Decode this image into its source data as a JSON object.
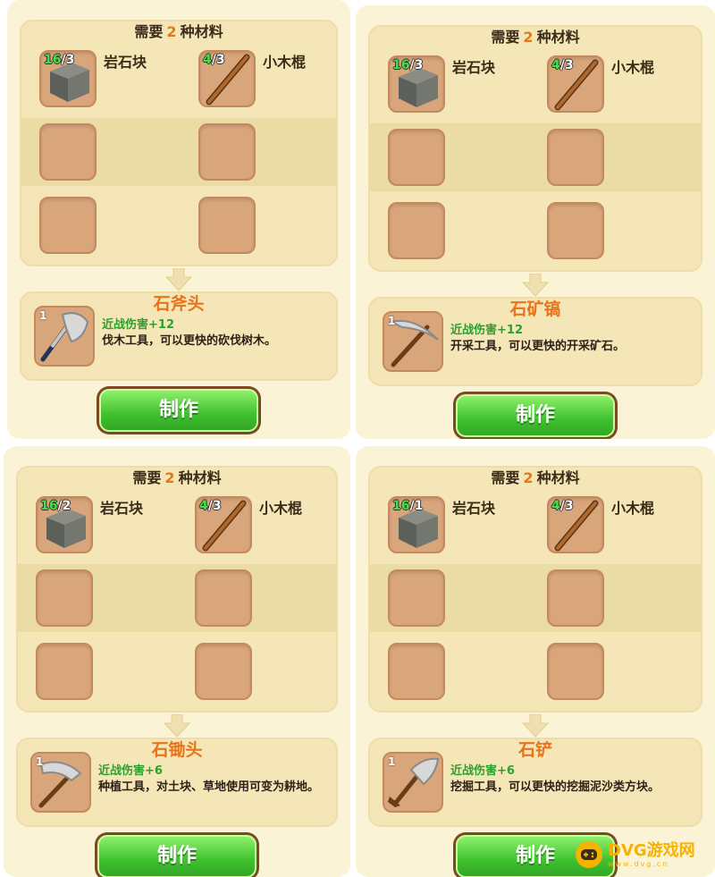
{
  "recipes": [
    {
      "req_prefix": "需要",
      "req_count": "2",
      "req_suffix": "种材料",
      "materials": [
        {
          "have": "16",
          "need": "/3",
          "name": "岩石块",
          "icon": "stone-block-icon"
        },
        {
          "have": "4",
          "need": "/3",
          "name": "小木棍",
          "icon": "wooden-stick-icon"
        }
      ],
      "result": {
        "name": "石斧头",
        "qty": "1",
        "stat": "近战伤害+12",
        "desc": "伐木工具，可以更快的砍伐树木。",
        "icon": "stone-axe-icon"
      },
      "craft_label": "制作"
    },
    {
      "req_prefix": "需要",
      "req_count": "2",
      "req_suffix": "种材料",
      "materials": [
        {
          "have": "16",
          "need": "/3",
          "name": "岩石块",
          "icon": "stone-block-icon"
        },
        {
          "have": "4",
          "need": "/3",
          "name": "小木棍",
          "icon": "wooden-stick-icon"
        }
      ],
      "result": {
        "name": "石矿镐",
        "qty": "1",
        "stat": "近战伤害+12",
        "desc": "开采工具，可以更快的开采矿石。",
        "icon": "stone-pickaxe-icon"
      },
      "craft_label": "制作"
    },
    {
      "req_prefix": "需要",
      "req_count": "2",
      "req_suffix": "种材料",
      "materials": [
        {
          "have": "16",
          "need": "/2",
          "name": "岩石块",
          "icon": "stone-block-icon"
        },
        {
          "have": "4",
          "need": "/3",
          "name": "小木棍",
          "icon": "wooden-stick-icon"
        }
      ],
      "result": {
        "name": "石锄头",
        "qty": "1",
        "stat": "近战伤害+6",
        "desc": "种植工具，对土块、草地使用可变为耕地。",
        "icon": "stone-hoe-icon"
      },
      "craft_label": "制作"
    },
    {
      "req_prefix": "需要",
      "req_count": "2",
      "req_suffix": "种材料",
      "materials": [
        {
          "have": "16",
          "need": "/1",
          "name": "岩石块",
          "icon": "stone-block-icon"
        },
        {
          "have": "4",
          "need": "/3",
          "name": "小木棍",
          "icon": "wooden-stick-icon"
        }
      ],
      "result": {
        "name": "石铲",
        "qty": "1",
        "stat": "近战伤害+6",
        "desc": "挖掘工具，可以更快的挖掘泥沙类方块。",
        "icon": "stone-shovel-icon"
      },
      "craft_label": "制作"
    }
  ],
  "watermark": {
    "text": "DVG游戏网",
    "url": "www.dvg.cn",
    "icon": "gamepad-icon"
  },
  "colors": {
    "panel": "#fbf3d6",
    "slot": "#d9a57b",
    "accent": "#e9731a",
    "button": "#3fc12f",
    "stat": "#2ca02c"
  }
}
